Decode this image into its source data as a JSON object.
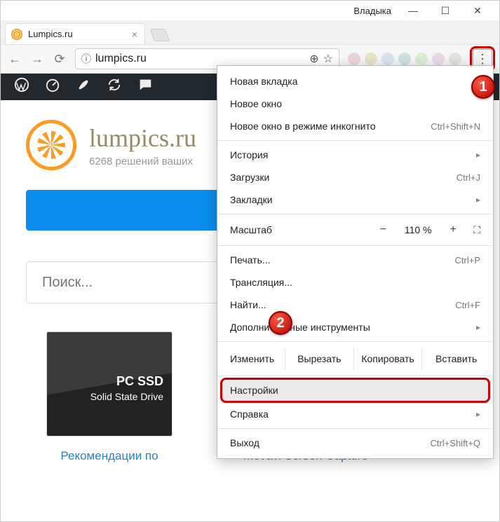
{
  "titlebar": {
    "user": "Владыка"
  },
  "tab": {
    "title": "Lumpics.ru"
  },
  "omnibox": {
    "url": "lumpics.ru"
  },
  "adminbar": {},
  "site": {
    "title": "lumpics.ru",
    "tagline": "6268 решений ваших"
  },
  "search": {
    "placeholder": "Поиск..."
  },
  "cards": {
    "ssd": {
      "l1": "PC SSD",
      "l2": "Solid State Drive",
      "caption": "Рекомендации по"
    },
    "movavi": {
      "caption": "Movavi Screen Capture"
    }
  },
  "menu": {
    "new_tab": "Новая вкладка",
    "new_window": "Новое окно",
    "incognito": "Новое окно в режиме инкогнито",
    "incognito_sc": "Ctrl+Shift+N",
    "history": "История",
    "downloads": "Загрузки",
    "downloads_sc": "Ctrl+J",
    "bookmarks": "Закладки",
    "zoom_label": "Масштаб",
    "zoom_value": "110 %",
    "print": "Печать...",
    "print_sc": "Ctrl+P",
    "cast": "Трансляция...",
    "find": "Найти...",
    "find_sc": "Ctrl+F",
    "more_tools": "Дополнительные инструменты",
    "edit_label": "Изменить",
    "cut": "Вырезать",
    "copy": "Копировать",
    "paste": "Вставить",
    "settings": "Настройки",
    "help": "Справка",
    "exit": "Выход",
    "exit_sc": "Ctrl+Shift+Q"
  },
  "badges": {
    "one": "1",
    "two": "2"
  },
  "ext_colors": [
    "#d89b9b",
    "#c8c070",
    "#a8bce0",
    "#7db9b4",
    "#a8d79b",
    "#d0a0d0",
    "#bdbdbd"
  ]
}
